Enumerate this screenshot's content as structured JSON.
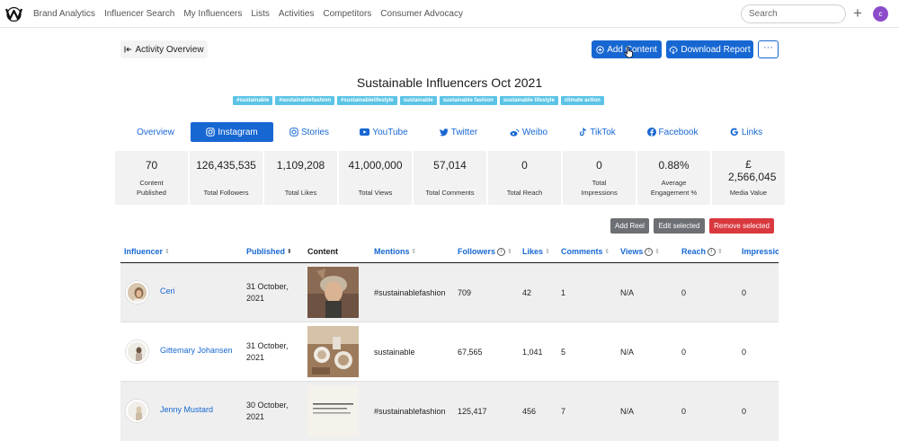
{
  "nav": {
    "links": [
      "Brand Analytics",
      "Influencer Search",
      "My Influencers",
      "Lists",
      "Activities",
      "Competitors",
      "Consumer Advocacy"
    ],
    "search_placeholder": "Search",
    "plus": "+",
    "user_initial": "c"
  },
  "actions": {
    "back_label": "Activity Overview",
    "add_content": "Add Content",
    "download_report": "Download Report",
    "more": "···"
  },
  "page": {
    "title": "Sustainable Influencers Oct 2021",
    "tags": [
      "#sustainable",
      "#sustainablefashion",
      "#sustainablelifestyle",
      "sustainable",
      "sustainable fashion",
      "sustainable lifestyle",
      "climate action"
    ]
  },
  "tabs": [
    "Overview",
    "Instagram",
    "Stories",
    "YouTube",
    "Twitter",
    "Weibo",
    "TikTok",
    "Facebook",
    "Links"
  ],
  "active_tab": "Instagram",
  "stats": [
    {
      "value": "70",
      "label": "Content Published"
    },
    {
      "value": "126,435,535",
      "label": "Total Followers"
    },
    {
      "value": "1,109,208",
      "label": "Total Likes"
    },
    {
      "value": "41,000,000",
      "label": "Total Views"
    },
    {
      "value": "57,014",
      "label": "Total Comments"
    },
    {
      "value": "0",
      "label": "Total Reach"
    },
    {
      "value": "0",
      "label": "Total Impressions"
    },
    {
      "value": "0.88%",
      "label": "Average Engagement %"
    },
    {
      "value": "£ 2,566,045",
      "label": "Media Value"
    }
  ],
  "table_actions": {
    "add_reel": "Add Reel",
    "edit_selected": "Edit selected",
    "remove_selected": "Remove selected"
  },
  "table": {
    "columns": [
      "Influencer",
      "Published",
      "Content",
      "Mentions",
      "Followers",
      "Likes",
      "Comments",
      "Views",
      "Reach",
      "Impressions"
    ],
    "rows": [
      {
        "influencer": "Ceri",
        "published": "31 October, 2021",
        "mentions": "#sustainablefashion",
        "followers": "709",
        "likes": "42",
        "comments": "1",
        "views": "N/A",
        "reach": "0",
        "impressions": "0"
      },
      {
        "influencer": "Gittemary Johansen",
        "published": "31 October, 2021",
        "mentions": "sustainable",
        "followers": "67,565",
        "likes": "1,041",
        "comments": "5",
        "views": "N/A",
        "reach": "0",
        "impressions": "0"
      },
      {
        "influencer": "Jenny Mustard",
        "published": "30 October, 2021",
        "mentions": "#sustainablefashion",
        "followers": "125,417",
        "likes": "456",
        "comments": "7",
        "views": "N/A",
        "reach": "0",
        "impressions": "0"
      }
    ]
  },
  "colors": {
    "primary": "#1767d2",
    "tag": "#5bc4e6",
    "danger": "#d9393e",
    "secondary": "#6c6f73"
  }
}
